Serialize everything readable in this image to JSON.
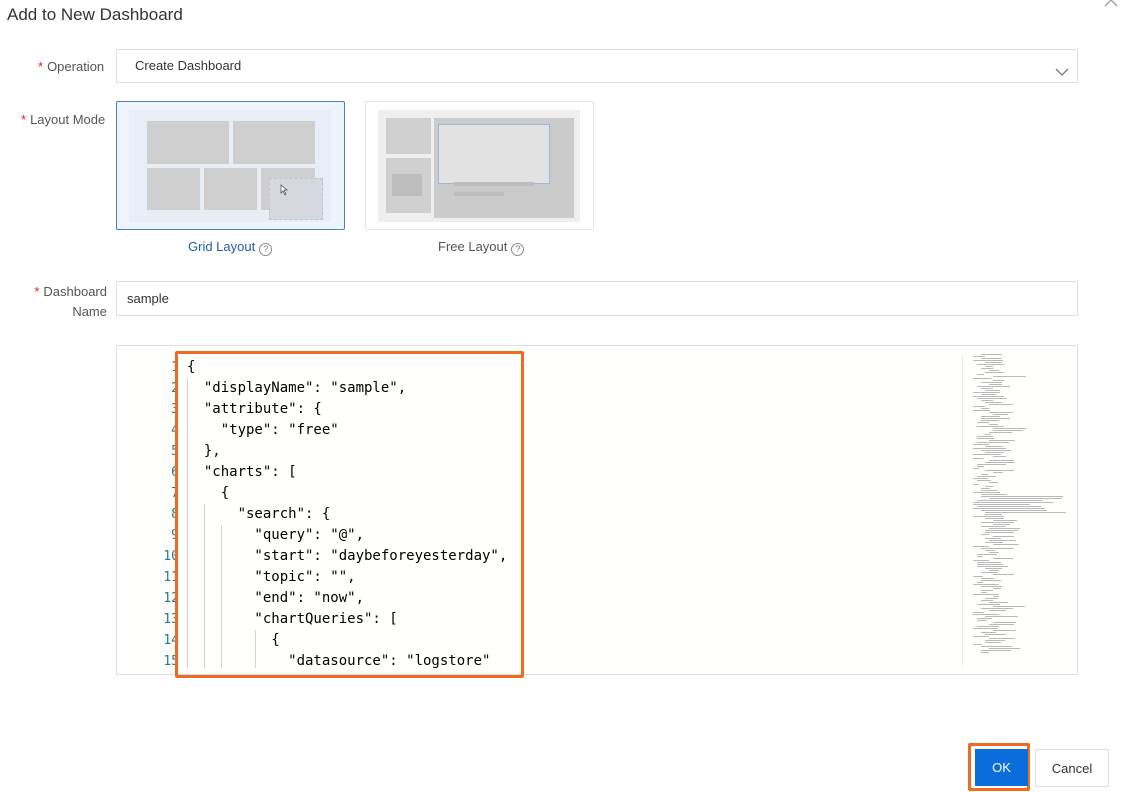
{
  "dialog": {
    "title": "Add to New Dashboard"
  },
  "operation": {
    "label": "Operation",
    "value": "Create Dashboard"
  },
  "layout_mode": {
    "label": "Layout Mode",
    "options": [
      {
        "label": "Grid Layout",
        "selected": true
      },
      {
        "label": "Free Layout",
        "selected": false
      }
    ]
  },
  "dashboard_name": {
    "label_line1": "Dashboard",
    "label_line2": "Name",
    "value": "sample"
  },
  "editor": {
    "line_numbers": [
      "1",
      "2",
      "3",
      "4",
      "5",
      "6",
      "7",
      "8",
      "9",
      "10",
      "11",
      "12",
      "13",
      "14",
      "15"
    ],
    "lines": [
      "{",
      "  \"displayName\": \"sample\",",
      "  \"attribute\": {",
      "    \"type\": \"free\"",
      "  },",
      "  \"charts\": [",
      "    {",
      "      \"search\": {",
      "        \"query\": \"@\",",
      "        \"start\": \"daybeforeyesterday\",",
      "        \"topic\": \"\",",
      "        \"end\": \"now\",",
      "        \"chartQueries\": [",
      "          {",
      "            \"datasource\": \"logstore\""
    ]
  },
  "buttons": {
    "ok": "OK",
    "cancel": "Cancel"
  },
  "colors": {
    "primary": "#0a6ddb",
    "highlight": "#f06a20",
    "required": "#e02020",
    "selected_link": "#1f5ea8"
  },
  "icons": {
    "close": "close-icon",
    "dropdown": "chevron-down-icon",
    "help": "help-icon"
  }
}
